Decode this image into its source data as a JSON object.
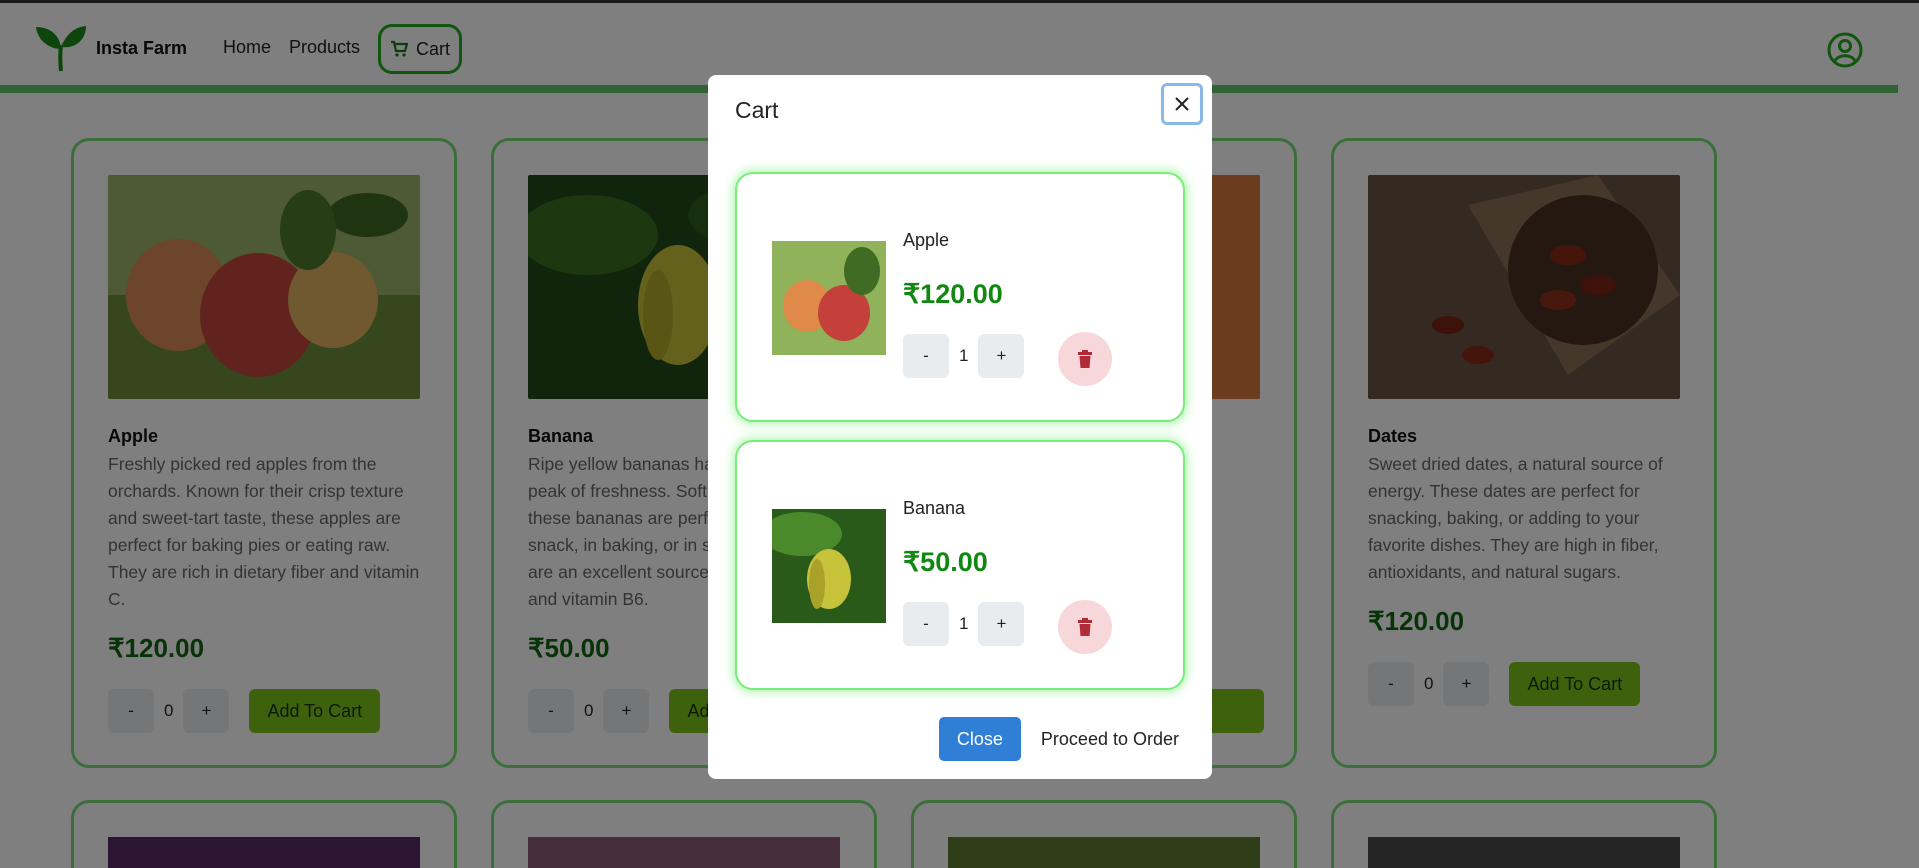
{
  "app": {
    "brand": "Insta Farm"
  },
  "nav": {
    "home": "Home",
    "products": "Products",
    "cart": "Cart"
  },
  "products": [
    {
      "name": "Apple",
      "description": "Freshly picked red apples from the orchards. Known for their crisp texture and sweet-tart taste, these apples are perfect for baking pies or eating raw. They are rich in dietary fiber and vitamin C.",
      "price": "₹120.00",
      "qty": "0",
      "add_label": "Add To Cart"
    },
    {
      "name": "Banana",
      "description": "Ripe yellow bananas harvested at the peak of freshness. Soft and sweet, these bananas are perfect as a quick snack, in baking, or in smoothies. They are an excellent source of potassium and vitamin B6.",
      "price": "₹50.00",
      "qty": "0",
      "add_label": "Add To Cart"
    },
    {
      "name": "",
      "description": "",
      "price": "",
      "qty": "",
      "add_label": ""
    },
    {
      "name": "Dates",
      "description": "Sweet dried dates, a natural source of energy. These dates are perfect for snacking, baking, or adding to your favorite dishes. They are high in fiber, antioxidants, and natural sugars.",
      "price": "₹120.00",
      "qty": "0",
      "add_label": "Add To Cart"
    }
  ],
  "buttons": {
    "minus": "-",
    "plus": "+"
  },
  "modal": {
    "title": "Cart",
    "items": [
      {
        "name": "Apple",
        "price": "₹120.00",
        "qty": "1"
      },
      {
        "name": "Banana",
        "price": "₹50.00",
        "qty": "1"
      }
    ],
    "close_label": "Close",
    "proceed_label": "Proceed to Order"
  },
  "colors": {
    "accent": "#62c462",
    "price": "#116611",
    "primary": "#2f7fd6",
    "add": "#7cc21d"
  },
  "icons": [
    "leaf-logo-icon",
    "cart-icon",
    "user-icon",
    "close-icon",
    "trash-icon"
  ]
}
